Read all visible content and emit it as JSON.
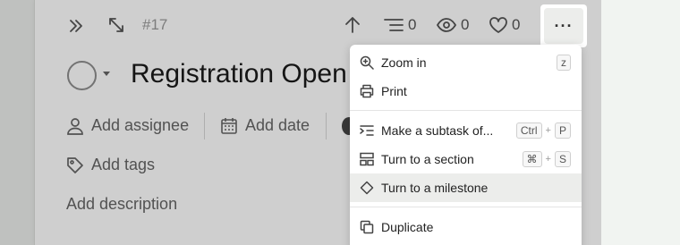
{
  "task": {
    "number": "#17",
    "title": "Registration Open",
    "subtask_count": "0",
    "watcher_count": "0",
    "like_count": "0"
  },
  "fields": {
    "assignee": "Add assignee",
    "date": "Add date",
    "tags": "Add tags",
    "description": "Add description"
  },
  "more_button": {
    "label": "···"
  },
  "menu": {
    "zoom_in": {
      "label": "Zoom in",
      "key": "z"
    },
    "print": {
      "label": "Print"
    },
    "make_subtask": {
      "label": "Make a subtask of...",
      "key1": "Ctrl",
      "key2": "P"
    },
    "turn_section": {
      "label": "Turn to a section",
      "key1": "⌘",
      "key2": "S"
    },
    "turn_milestone": {
      "label": "Turn to a milestone"
    },
    "duplicate": {
      "label": "Duplicate"
    }
  },
  "shortcut_joiner": "+"
}
